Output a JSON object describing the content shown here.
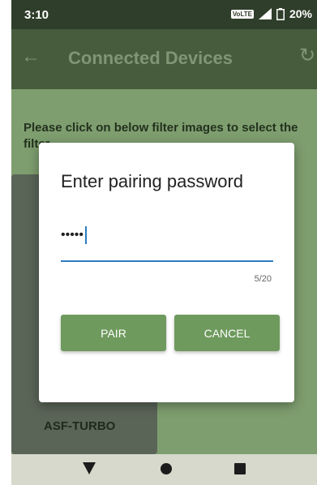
{
  "status_bar": {
    "time": "3:10",
    "network": "VoLTE",
    "battery": "20%"
  },
  "app_bar": {
    "title": "Connected Devices",
    "back_icon": "arrow-left",
    "refresh_icon": "refresh"
  },
  "content": {
    "instruction": "Please click on below filter images to select the filter",
    "filter_label": "ASF-TURBO"
  },
  "dialog": {
    "title": "Enter pairing password",
    "password_value": "•••••",
    "counter": "5/20",
    "pair_label": "PAIR",
    "cancel_label": "CANCEL"
  },
  "nav_bar": {
    "back_icon": "triangle",
    "home_icon": "circle",
    "recents_icon": "square"
  },
  "colors": {
    "primary": "#6e9a5d",
    "accent": "#2b7bbf",
    "status_bar": "#2f3e2a"
  }
}
